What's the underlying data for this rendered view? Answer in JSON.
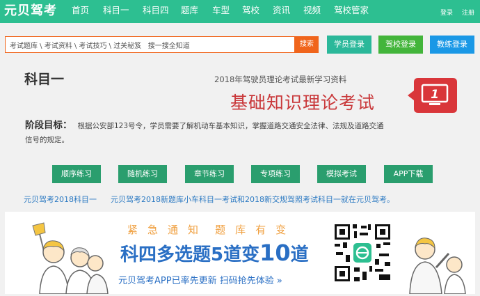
{
  "brand": {
    "logo": "元贝驾考"
  },
  "nav": {
    "items": [
      "首页",
      "科目一",
      "科目四",
      "题库",
      "车型",
      "驾校",
      "资讯",
      "视频",
      "驾校管家"
    ],
    "login": "登录",
    "register": "注册"
  },
  "search": {
    "value": "考试题库 \\ 考试资料 \\ 考试技巧 \\ 过关秘笈   搜一搜全知道",
    "button": "搜索"
  },
  "buttons": {
    "student_login": "学员登录",
    "school_login": "驾校登录",
    "coach_login": "教练登录"
  },
  "page": {
    "title": "科目一",
    "promo_sub": "2018年驾驶员理论考试最新学习资料",
    "promo_main": "基础知识理论考试",
    "monitor_number": "1",
    "goal_label": "阶段目标：",
    "goal_text": "根据公安部123号令，学员需要了解机动车基本知识，掌握道路交通安全法律、法规及道路交通信号的规定。"
  },
  "practice": [
    "顺序练习",
    "随机练习",
    "章节练习",
    "专项练习",
    "模拟考试",
    "APP下载"
  ],
  "links": {
    "link1": "元贝驾考2018科目一",
    "link2": "元贝驾考2018新题库小车科目一考试和2018新交规驾照考试科目一就在元贝驾考。"
  },
  "banner": {
    "top_chars": [
      "紧",
      "急",
      "通",
      "知",
      "题",
      "库",
      "有",
      "变"
    ],
    "headline_pre": "科四多选题5道变",
    "headline_num": "10",
    "headline_post": "道",
    "bottom": "元贝驾考APP已率先更新   扫码抢先体验 »"
  },
  "colors": {
    "nav_bg": "#2dbf91",
    "search_orange": "#f0651c",
    "student_btn": "#2bb89a",
    "school_btn": "#43b53b",
    "coach_btn": "#1a98e6",
    "practice_btn": "#2a9e6e",
    "promo_red": "#c9383a",
    "link_blue": "#2b79c2"
  }
}
